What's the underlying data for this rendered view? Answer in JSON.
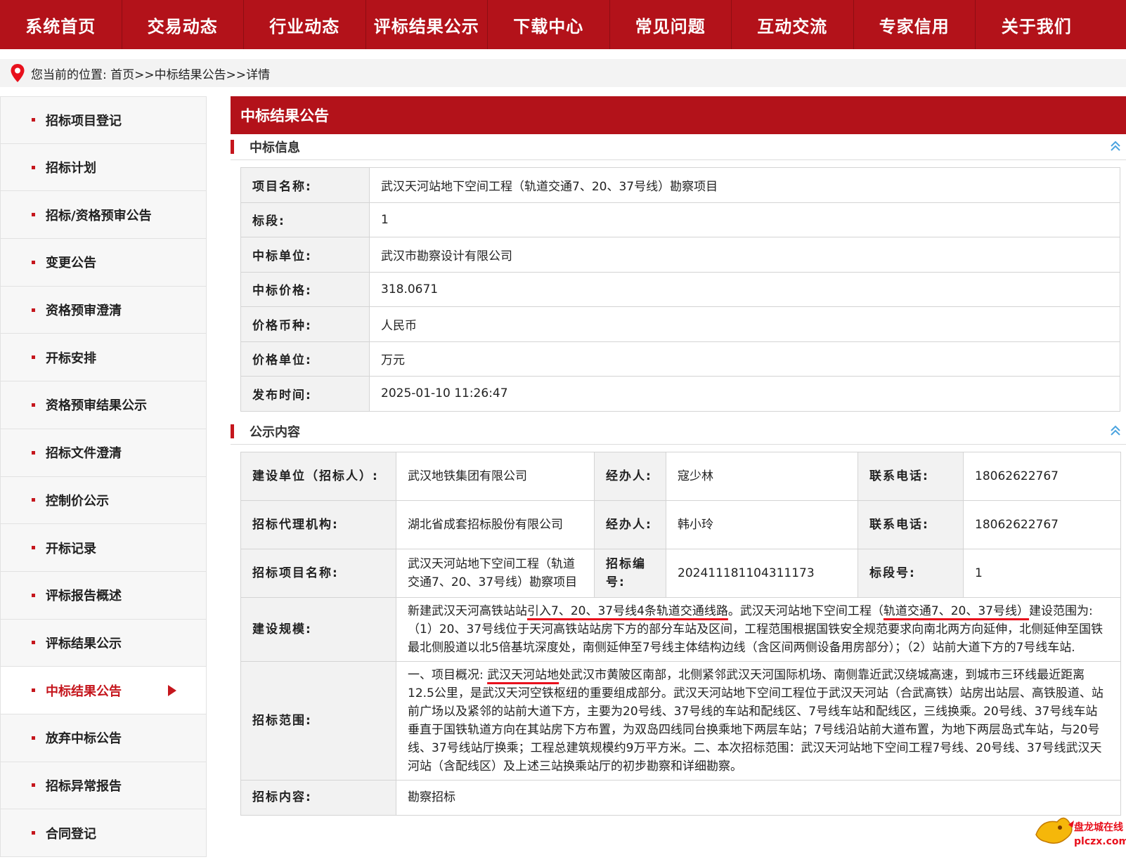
{
  "nav": [
    {
      "label": "系统首页"
    },
    {
      "label": "交易动态"
    },
    {
      "label": "行业动态"
    },
    {
      "label": "评标结果公示"
    },
    {
      "label": "下载中心"
    },
    {
      "label": "常见问题"
    },
    {
      "label": "互动交流"
    },
    {
      "label": "专家信用"
    },
    {
      "label": "关于我们"
    }
  ],
  "breadcrumb": {
    "text": "您当前的位置: 首页>>中标结果公告>>详情"
  },
  "sidebar": {
    "items": [
      {
        "label": "招标项目登记"
      },
      {
        "label": "招标计划"
      },
      {
        "label": "招标/资格预审公告"
      },
      {
        "label": "变更公告"
      },
      {
        "label": "资格预审澄清"
      },
      {
        "label": "开标安排"
      },
      {
        "label": "资格预审结果公示"
      },
      {
        "label": "招标文件澄清"
      },
      {
        "label": "控制价公示"
      },
      {
        "label": "开标记录"
      },
      {
        "label": "评标报告概述"
      },
      {
        "label": "评标结果公示"
      },
      {
        "label": "中标结果公告",
        "active": true
      },
      {
        "label": "放弃中标公告"
      },
      {
        "label": "招标异常报告"
      },
      {
        "label": "合同登记"
      }
    ]
  },
  "main": {
    "title": "中标结果公告",
    "info_section": {
      "title": "中标信息",
      "rows": [
        {
          "key": "项目名称:",
          "value": "武汉天河站地下空间工程（轨道交通7、20、37号线）勘察项目"
        },
        {
          "key": "标段:",
          "value": "1"
        },
        {
          "key": "中标单位:",
          "value": "武汉市勘察设计有限公司"
        },
        {
          "key": "中标价格:",
          "value": "318.0671"
        },
        {
          "key": "价格币种:",
          "value": "人民币"
        },
        {
          "key": "价格单位:",
          "value": "万元"
        },
        {
          "key": "发布时间:",
          "value": "2025-01-10 11:26:47"
        }
      ]
    },
    "pub_section": {
      "title": "公示内容",
      "builder_key": "建设单位（招标人）:",
      "builder_value": "武汉地铁集团有限公司",
      "handler_key": "经办人:",
      "handler1_value": "寇少林",
      "phone_key": "联系电话:",
      "phone1_value": "18062622767",
      "agency_key": "招标代理机构:",
      "agency_value": "湖北省成套招标股份有限公司",
      "handler2_value": "韩小玲",
      "phone2_value": "18062622767",
      "project_key": "招标项目名称:",
      "project_value": "武汉天河站地下空间工程（轨道交通7、20、37号线）勘察项目",
      "code_key": "招标编号:",
      "code_value": "202411181104311173",
      "section_no_key": "标段号:",
      "section_no_value": "1",
      "scale_key": "建设规模:",
      "scale_p1": "新建武汉天河高铁站站",
      "scale_u1": "引入7、20、37号线4条轨道交通线路",
      "scale_p2": "。武汉天河站地下空间工程（",
      "scale_u2": "轨道交通7、20、37号线）",
      "scale_p3": "建设范围为:（1）20、37号线位于天河高铁站站房下方的部分车站及区间，工程范围根据国铁安全规范要求向南北两方向延伸，北侧延伸至国铁最北侧股道以北5倍基坑深度处，南侧延伸至7号线主体结构边线（含区间两侧设备用房部分）；（2）站前大道下方的7号线车站.",
      "scope_key": "招标范围:",
      "scope_p1": "一、项目概况: ",
      "scope_u1": "武汉天河站地",
      "scope_p2": "处武汉市黄陂区南部，北侧紧邻武汉天河国际机场、南侧靠近武汉绕城高速，到城市三环线最近距离12.5公里，是武汉天河空铁枢纽的重要组成部分。武汉天河站地下空间工程位于武汉天河站（合武高铁）站房出站层、高铁股道、站前广场以及紧邻的站前大道下方，主要为20号线、37号线的车站和配线区、7号线车站和配线区，三线换乘。20号线、37号线车站垂直于国铁轨道方向在其站房下方布置，为双岛四线同台换乘地下两层车站；7号线沿站前大道布置，为地下两层岛式车站，与20号线、37号线站厅换乘；工程总建筑规模约9万平方米。二、本次招标范围：武汉天河站地下空间工程7号线、20号线、37号线武汉天河站（含配线区）及上述三站换乘站厅的初步勘察和详细勘察。",
      "content_key": "招标内容:",
      "content_value": "勘察招标"
    }
  },
  "watermark": {
    "line1": "盘龙城在线",
    "line2": "plczx.com"
  },
  "colors": {
    "brand_red": "#b3121a",
    "accent_red": "#c5161d",
    "underline_red": "#e8101c"
  }
}
